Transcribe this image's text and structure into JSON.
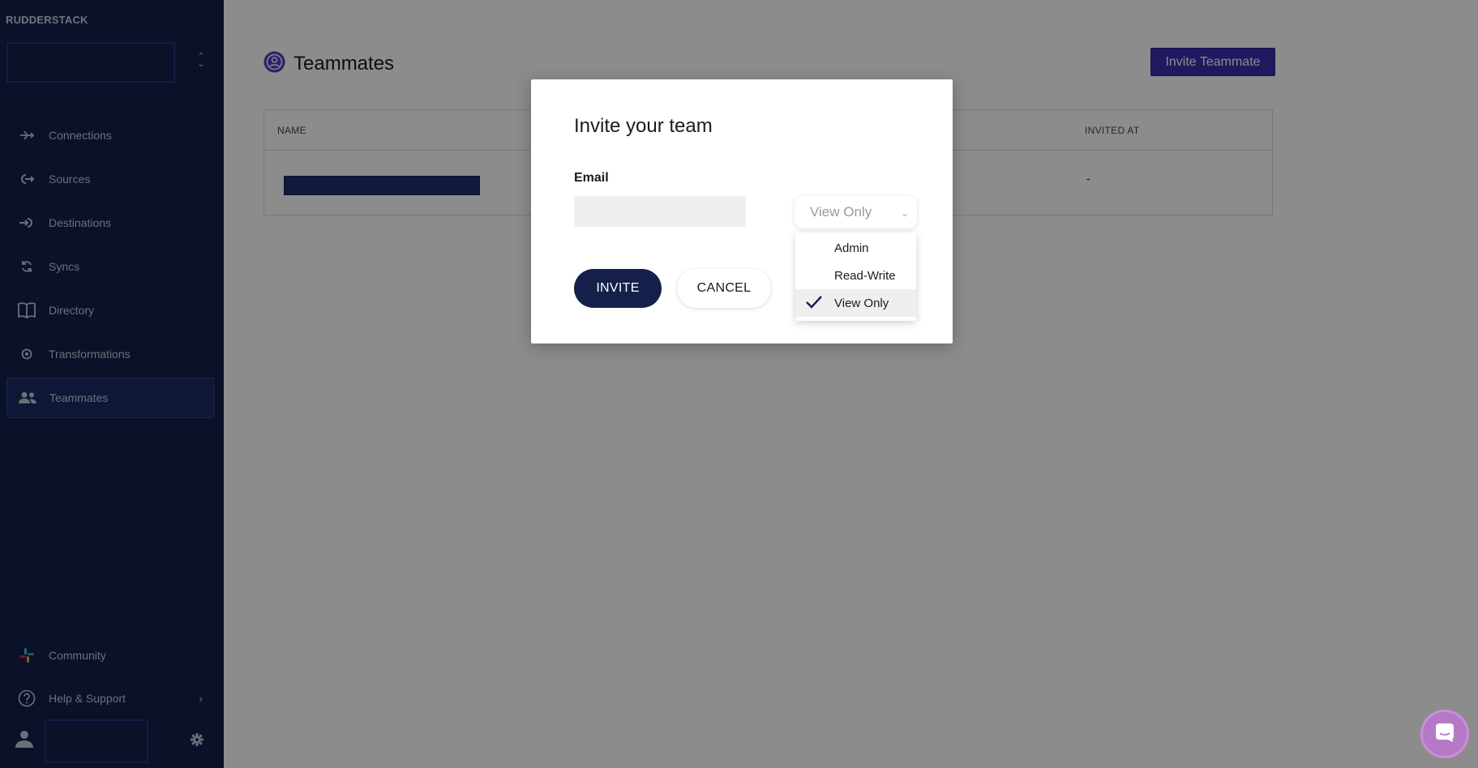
{
  "sidebar": {
    "logo": "RUDDERSTACK",
    "nav_items": [
      {
        "label": "Connections",
        "icon": "connections-icon"
      },
      {
        "label": "Sources",
        "icon": "sources-icon"
      },
      {
        "label": "Destinations",
        "icon": "destinations-icon"
      },
      {
        "label": "Syncs",
        "icon": "syncs-icon"
      },
      {
        "label": "Directory",
        "icon": "book-icon"
      },
      {
        "label": "Transformations",
        "icon": "transformations-icon"
      },
      {
        "label": "Teammates",
        "icon": "people-icon",
        "active": true
      }
    ],
    "bottom_items": [
      {
        "label": "Community",
        "icon": "slack-icon"
      },
      {
        "label": "Help & Support",
        "icon": "help-icon"
      }
    ]
  },
  "main": {
    "page_title": "Teammates",
    "invite_button": "Invite Teammate",
    "table": {
      "columns": [
        "NAME",
        "INVITED AT"
      ],
      "rows": [
        {
          "invited_at": "-"
        }
      ]
    }
  },
  "modal": {
    "title": "Invite your team",
    "email_label": "Email",
    "email_value": "",
    "role_selected": "View Only",
    "invite_label": "INVITE",
    "cancel_label": "CANCEL"
  },
  "dropdown": {
    "options": [
      "Admin",
      "Read-Write",
      "View Only"
    ],
    "selected": "View Only"
  },
  "colors": {
    "sidebar_bg": "#15204a",
    "accent": "#3a2fb0",
    "chat_bubble": "#b579c7"
  }
}
